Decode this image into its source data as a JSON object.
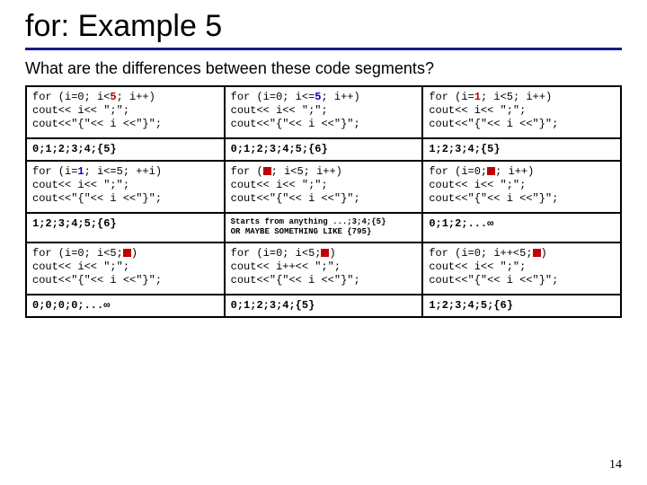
{
  "title": "for: Example 5",
  "subtitle": "What are the differences between these code segments?",
  "page_number": "14",
  "std_body": {
    "l1a": " cout<< i<< \";\";",
    "l1b": "   cout<< i<< \";\";",
    "l2": "cout<<\"{\"<< i <<\"}\";"
  },
  "rows": [
    {
      "code": [
        {
          "line1_pre": "for (i=0; i<",
          "line1_hl": "5",
          "line1_post": "; i++)",
          "cls": "hl-red",
          "body": "std"
        },
        {
          "line1_pre": "for (i=0; i<=",
          "line1_hl": "5",
          "line1_post": "; i++)",
          "cls": "hl-blue",
          "body": "std_indent"
        },
        {
          "line1_pre": "for (i=",
          "line1_hl": "1",
          "line1_post": "; i<5; i++)",
          "cls": "hl-red",
          "body": "std"
        }
      ],
      "out": [
        "0;1;2;3;4;{5}",
        "0;1;2;3;4;5;{6}",
        "1;2;3;4;{5}"
      ]
    },
    {
      "code": [
        {
          "line1_pre": "for (i=",
          "line1_hl": "1",
          "line1_post": "; i<=5; ++i)",
          "cls": "hl-blue",
          "body": "std"
        },
        {
          "line1_pre": "for (",
          "line1_hl": "BLOCK",
          "line1_post": "; i<5; i++)",
          "cls": "",
          "body": "std_indent"
        },
        {
          "line1_pre": "for (i=0;",
          "line1_hl": "BLOCK",
          "line1_post": "; i++)",
          "cls": "",
          "body": "std_indent2"
        }
      ],
      "out": [
        "1;2;3;4;5;{6}",
        {
          "note": true,
          "text": "Starts from anything ...;3;4;{5}\nOR MAYBE SOMETHING LIKE {795}"
        },
        "0;1;2;...∞"
      ]
    },
    {
      "code": [
        {
          "line1_pre": "for (i=0; i<5;",
          "line1_hl": "BLOCK",
          "line1_post": ")",
          "cls": "",
          "body": "std"
        },
        {
          "raw": "for (i=0; i<5;<span class=\"blk\"></span>)\n  cout<< i++<< \";\";\n cout<<\"{\"<< i <<\"}\";"
        },
        {
          "raw": "for (i=0; i++<5;<span class=\"blk\"></span>)\n  cout<< i<< \";\";\ncout<<\"{\"<< i <<\"}\";"
        }
      ],
      "out": [
        "0;0;0;0;...∞",
        "0;1;2;3;4;{5}",
        "1;2;3;4;5;{6}"
      ]
    }
  ]
}
